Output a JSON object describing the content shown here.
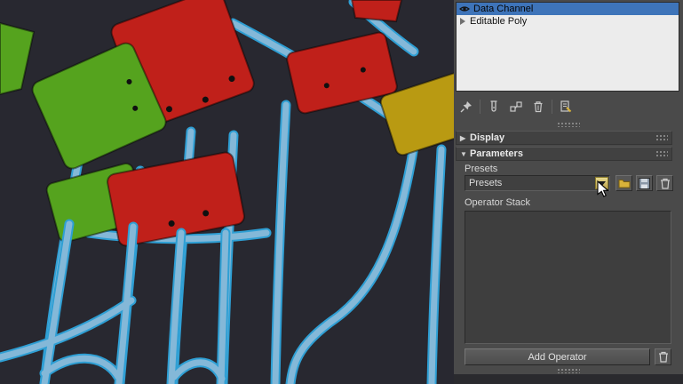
{
  "colors": {
    "selection_blue": "#3e74b9",
    "chair_red": "#c0201a",
    "chair_green": "#55a31e",
    "chair_yellow": "#b99a12",
    "tube_blue": "#84b8d8",
    "tube_edge": "#2e9fd4",
    "viewport_bg": "#282830",
    "panel_bg": "#4a4a4a"
  },
  "modifier_stack": {
    "items": [
      {
        "label": "Data Channel",
        "selected": true
      },
      {
        "label": "Editable Poly",
        "selected": false
      }
    ]
  },
  "stack_toolbar": {
    "buttons": [
      "Pin Stack",
      "Show End Result",
      "Make Unique",
      "Remove Modifier",
      "Configure Modifier Sets"
    ]
  },
  "rollouts": {
    "display": {
      "label": "Display"
    },
    "parameters": {
      "label": "Parameters"
    }
  },
  "parameters": {
    "presets_label": "Presets",
    "presets_value": "Presets",
    "operator_stack_label": "Operator Stack",
    "add_operator_label": "Add Operator"
  }
}
